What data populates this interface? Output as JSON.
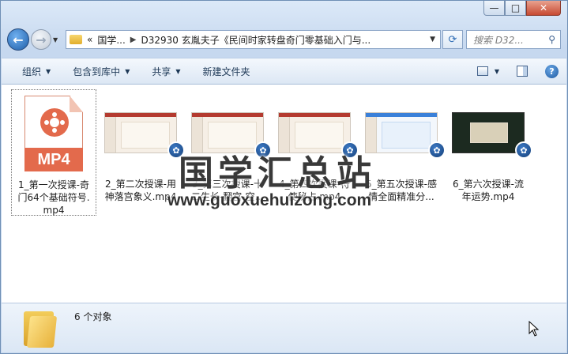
{
  "window": {
    "minimize": "—",
    "maximize": "□",
    "close": "✕"
  },
  "nav": {
    "back_icon": "arrow-left-icon",
    "forward_icon": "arrow-right-icon",
    "address": {
      "overflow": "«",
      "crumbs": [
        "国学...",
        "D32930  玄胤夫子《民间时家转盘奇门零基础入门与..."
      ]
    },
    "search_placeholder": "搜索 D32..."
  },
  "toolbar": {
    "organize": "组织",
    "include_in_library": "包含到库中",
    "share": "共享",
    "new_folder": "新建文件夹"
  },
  "files": [
    {
      "line1": "1_第一次授课-奇",
      "line2": "门64个基础符号.",
      "line3": "mp4",
      "thumb": "mp4-file-icon",
      "selected": true
    },
    {
      "line1": "2_第二次授课-用",
      "line2": "神落宫象义.mp4",
      "line3": "",
      "thumb": "video-thumbnail"
    },
    {
      "line1": "3_第三次授课-十",
      "line2": "二生长-翻宫-空...",
      "line3": "",
      "thumb": "video-thumbnail"
    },
    {
      "line1": "4_第四次授课-符",
      "line2": "使秘占.mp4",
      "line3": "",
      "thumb": "video-thumbnail"
    },
    {
      "line1": "5_第五次授课-感",
      "line2": "情全面精准分...",
      "line3": "",
      "thumb": "video-thumbnail"
    },
    {
      "line1": "6_第六次授课-流",
      "line2": "年运势.mp4",
      "line3": "",
      "thumb": "video-thumbnail-dark"
    }
  ],
  "watermark": {
    "title": "国学汇总站",
    "url": "www.guoxuehuizong.com"
  },
  "details": {
    "count": "6 个对象"
  }
}
